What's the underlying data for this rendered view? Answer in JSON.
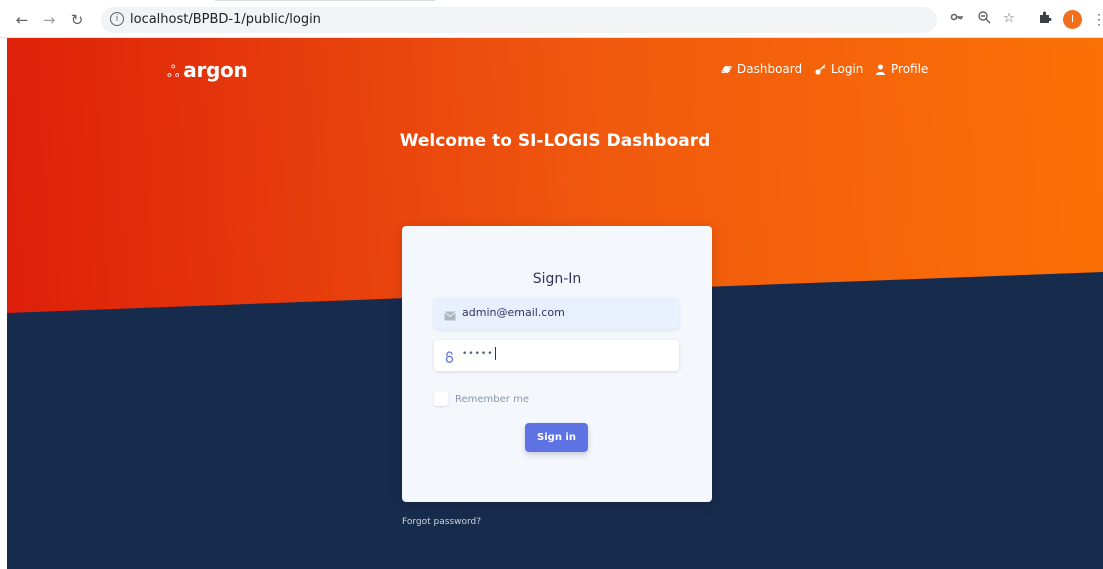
{
  "browser": {
    "url": "localhost/BPBD-1/public/login",
    "avatar_letter": "I",
    "icons": [
      "back-arrow-icon",
      "forward-arrow-icon",
      "reload-icon",
      "info-icon",
      "key-icon",
      "zoom-icon",
      "star-icon",
      "extensions-icon",
      "profile-avatar",
      "menu-icon"
    ]
  },
  "brand": {
    "name": "argon",
    "icon": "argon-logo-icon"
  },
  "nav": {
    "items": [
      {
        "label": "Dashboard",
        "icon": "planet-icon"
      },
      {
        "label": "Login",
        "icon": "key-icon"
      },
      {
        "label": "Profile",
        "icon": "user-icon"
      }
    ]
  },
  "hero": {
    "title": "Welcome to SI-LOGIS Dashboard"
  },
  "login": {
    "title": "Sign-In",
    "email_value": "admin@email.com",
    "password_value": "•••••",
    "remember_label": "Remember me",
    "submit_label": "Sign in",
    "forgot_label": "Forgot password?"
  },
  "colors": {
    "hero_start": "#dd1e0a",
    "hero_end": "#fb7106",
    "background": "#172b4d",
    "primary_button": "#5e72e4",
    "card": "#f4f7fb"
  }
}
